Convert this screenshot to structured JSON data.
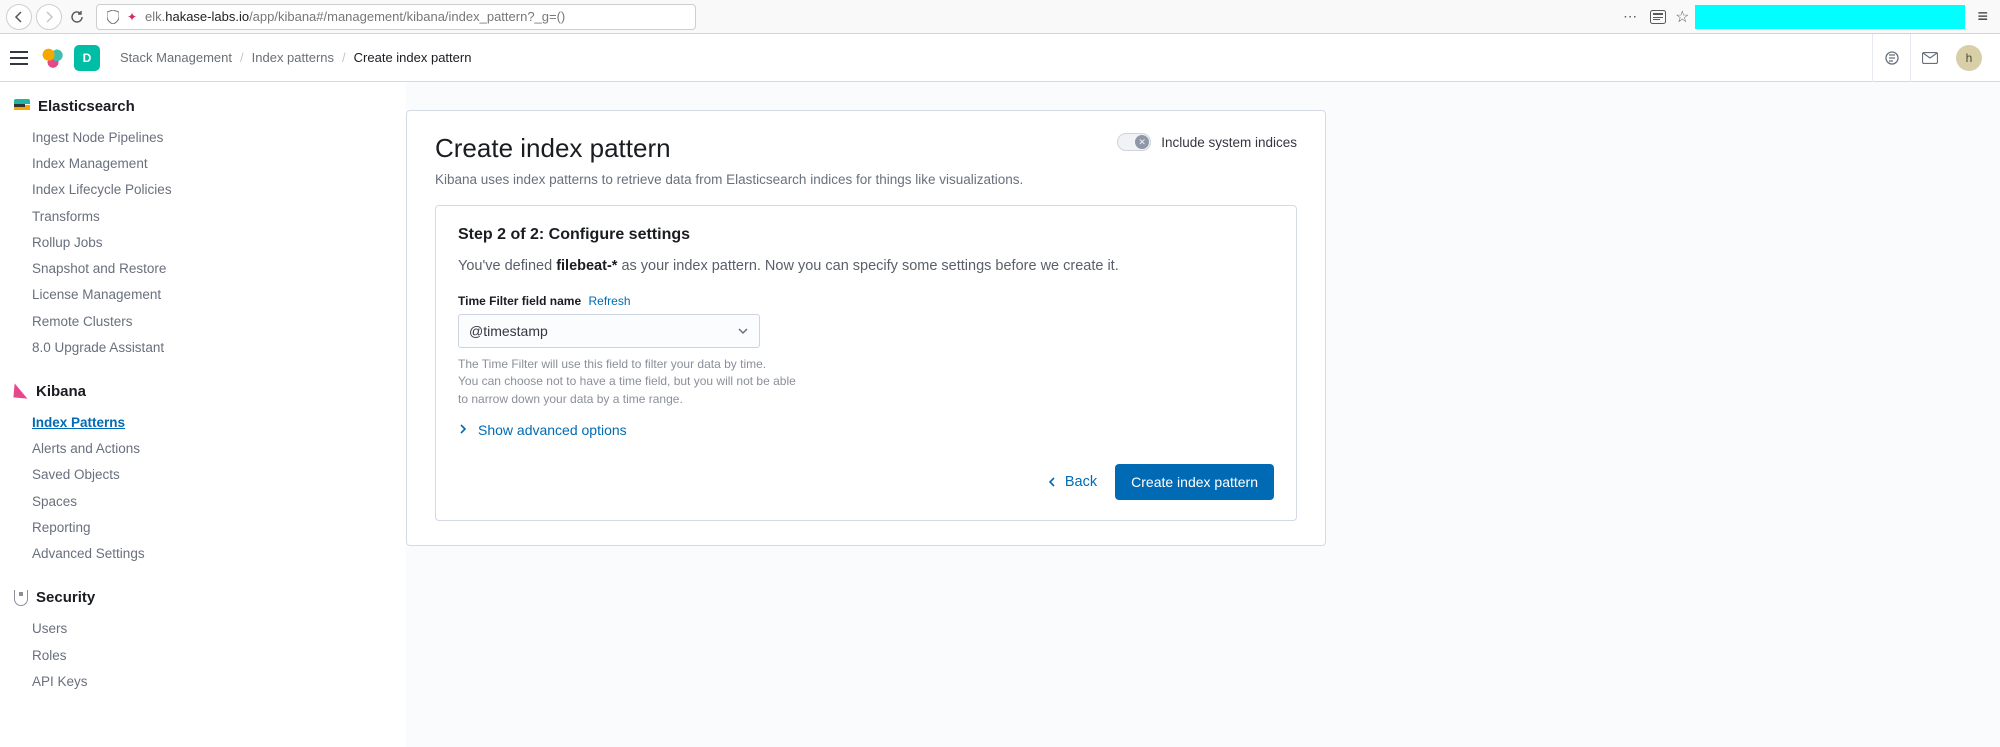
{
  "browser": {
    "url_prefix": "elk.",
    "url_host": "hakase-labs.io",
    "url_path": "/app/kibana#/management/kibana/index_pattern?_g=()"
  },
  "topbar": {
    "space_letter": "D",
    "avatar_letter": "h"
  },
  "breadcrumbs": [
    "Stack Management",
    "Index patterns",
    "Create index pattern"
  ],
  "sidebar": {
    "groups": [
      {
        "title": "Elasticsearch",
        "icon": "es",
        "items": [
          {
            "label": "Ingest Node Pipelines"
          },
          {
            "label": "Index Management"
          },
          {
            "label": "Index Lifecycle Policies"
          },
          {
            "label": "Transforms"
          },
          {
            "label": "Rollup Jobs"
          },
          {
            "label": "Snapshot and Restore"
          },
          {
            "label": "License Management"
          },
          {
            "label": "Remote Clusters"
          },
          {
            "label": "8.0 Upgrade Assistant"
          }
        ]
      },
      {
        "title": "Kibana",
        "icon": "kb",
        "items": [
          {
            "label": "Index Patterns",
            "active": true
          },
          {
            "label": "Alerts and Actions"
          },
          {
            "label": "Saved Objects"
          },
          {
            "label": "Spaces"
          },
          {
            "label": "Reporting"
          },
          {
            "label": "Advanced Settings"
          }
        ]
      },
      {
        "title": "Security",
        "icon": "sec",
        "items": [
          {
            "label": "Users"
          },
          {
            "label": "Roles"
          },
          {
            "label": "API Keys"
          }
        ]
      }
    ]
  },
  "page": {
    "title": "Create index pattern",
    "subtitle": "Kibana uses index patterns to retrieve data from Elasticsearch indices for things like visualizations.",
    "toggle_label": "Include system indices",
    "toggle_on": false
  },
  "step": {
    "title": "Step 2 of 2: Configure settings",
    "desc_pre": "You've defined ",
    "desc_pattern": "filebeat-*",
    "desc_post": " as your index pattern. Now you can specify some settings before we create it.",
    "field_label": "Time Filter field name",
    "refresh_label": "Refresh",
    "select_value": "@timestamp",
    "helper_l1": "The Time Filter will use this field to filter your data by time.",
    "helper_l2": "You can choose not to have a time field, but you will not be able to narrow down your data by a time range.",
    "adv_label": "Show advanced options",
    "back_label": "Back",
    "submit_label": "Create index pattern"
  }
}
